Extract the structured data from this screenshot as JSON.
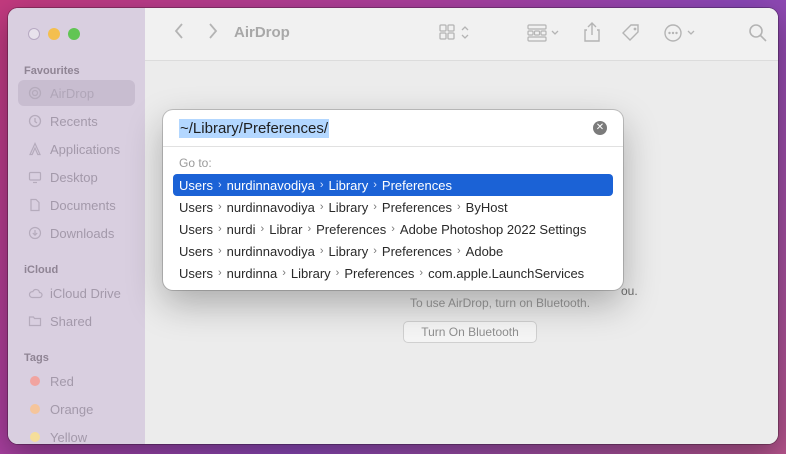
{
  "window": {
    "title": "AirDrop"
  },
  "sidebar": {
    "favourites_label": "Favourites",
    "favourites": [
      {
        "label": "AirDrop",
        "icon": "airdrop-icon",
        "selected": true
      },
      {
        "label": "Recents",
        "icon": "clock-icon"
      },
      {
        "label": "Applications",
        "icon": "applications-icon"
      },
      {
        "label": "Desktop",
        "icon": "desktop-icon"
      },
      {
        "label": "Documents",
        "icon": "document-icon"
      },
      {
        "label": "Downloads",
        "icon": "download-icon"
      }
    ],
    "icloud_label": "iCloud",
    "icloud": [
      {
        "label": "iCloud Drive",
        "icon": "cloud-icon"
      },
      {
        "label": "Shared",
        "icon": "shared-folder-icon"
      }
    ],
    "tags_label": "Tags",
    "tags": [
      {
        "label": "Red",
        "color": "#f1a4a0"
      },
      {
        "label": "Orange",
        "color": "#f5c59b"
      },
      {
        "label": "Yellow",
        "color": "#f5de9a"
      }
    ]
  },
  "main": {
    "airdrop_message": "To use AirDrop, turn on Bluetooth.",
    "airdrop_partial": "ou.",
    "bluetooth_button": "Turn On Bluetooth"
  },
  "goto_dialog": {
    "path": "~/Library/Preferences/",
    "goto_label": "Go to:",
    "results": [
      {
        "segments": [
          "Users",
          "nurdinnavodiya",
          "Library",
          "Preferences"
        ],
        "selected": true
      },
      {
        "segments": [
          "Users",
          "nurdinnavodiya",
          "Library",
          "Preferences",
          "ByHost"
        ]
      },
      {
        "segments": [
          "Users",
          "nurdi",
          "Librar",
          "Preferences",
          "Adobe Photoshop 2022 Settings"
        ]
      },
      {
        "segments": [
          "Users",
          "nurdinnavodiya",
          "Library",
          "Preferences",
          "Adobe"
        ]
      },
      {
        "segments": [
          "Users",
          "nurdinna",
          "Library",
          "Preferences",
          "com.apple.LaunchServices"
        ]
      }
    ]
  }
}
